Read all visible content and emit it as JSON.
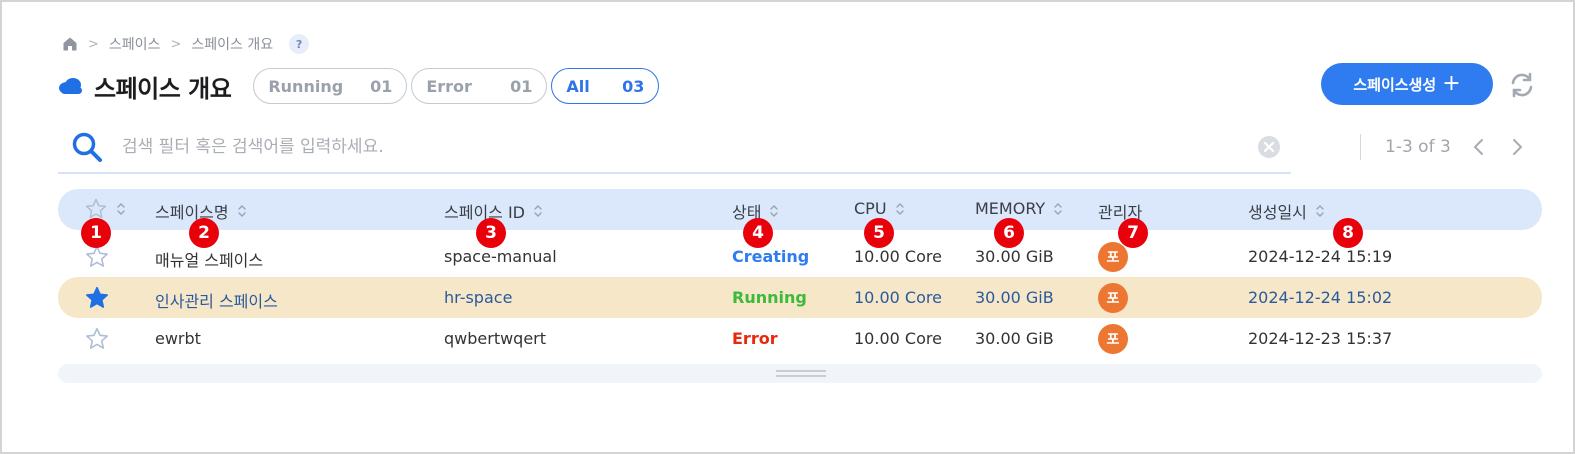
{
  "breadcrumb": {
    "items": [
      "스페이스",
      "스페이스 개요"
    ],
    "help": "?"
  },
  "header": {
    "title": "스페이스 개요"
  },
  "filters": [
    {
      "label": "Running",
      "count": "01"
    },
    {
      "label": "Error",
      "count": "01"
    },
    {
      "label": "All",
      "count": "03"
    }
  ],
  "actions": {
    "create_label": "스페이스생성",
    "create_plus": "+"
  },
  "search": {
    "placeholder": "검색 필터 혹은 검색어를 입력하세요.",
    "value": ""
  },
  "pagination": {
    "range": "1-3 of 3"
  },
  "table": {
    "columns": [
      "스페이스명",
      "스페이스 ID",
      "상태",
      "CPU",
      "MEMORY",
      "관리자",
      "생성일시"
    ],
    "rows": [
      {
        "favorite": false,
        "name": "매뉴얼 스페이스",
        "id": "space-manual",
        "status": "Creating",
        "cpu": "10.00 Core",
        "memory": "30.00 GiB",
        "admin": "포",
        "created": "2024-12-24 15:19"
      },
      {
        "favorite": true,
        "name": "인사관리 스페이스",
        "id": "hr-space",
        "status": "Running",
        "cpu": "10.00 Core",
        "memory": "30.00 GiB",
        "admin": "포",
        "created": "2024-12-24 15:02"
      },
      {
        "favorite": false,
        "name": "ewrbt",
        "id": "qwbertwqert",
        "status": "Error",
        "cpu": "10.00 Core",
        "memory": "30.00 GiB",
        "admin": "포",
        "created": "2024-12-23 15:37"
      }
    ]
  },
  "markers": [
    "1",
    "2",
    "3",
    "4",
    "5",
    "6",
    "7",
    "8"
  ],
  "colors": {
    "accent": "#2f7cf0",
    "status_creating": "#2f7cf0",
    "status_running": "#3cba3c",
    "status_error": "#e8290b",
    "highlight_row": "#f5e7c8",
    "link_text": "#2a5a9e",
    "avatar": "#ee7633",
    "marker": "#e8000b"
  }
}
